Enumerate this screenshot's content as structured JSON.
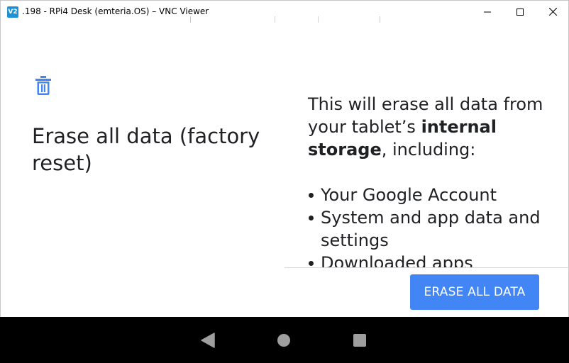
{
  "window": {
    "icon_text": "V2",
    "title": ".198 - RPi4 Desk (emteria.OS) – VNC Viewer"
  },
  "icons": {
    "app": "vnc-viewer-icon",
    "minimize": "minimize-icon",
    "maximize": "maximize-icon",
    "close": "close-icon",
    "trash": "trash-icon",
    "back": "back-triangle-icon",
    "home": "home-circle-icon",
    "recents": "recents-square-icon"
  },
  "page": {
    "title": "Erase all data (factory reset)",
    "description_before": "This will erase all data from your tablet’s ",
    "description_bold": "internal storage",
    "description_after": ", including:",
    "bullets": [
      "Your Google Account",
      "System and app data and settings",
      "Downloaded apps"
    ],
    "erase_button": "ERASE ALL DATA"
  },
  "colors": {
    "accent": "#4285f4",
    "text": "#202124",
    "navbar": "#000000",
    "nav_icons": "#9e9e9e"
  }
}
